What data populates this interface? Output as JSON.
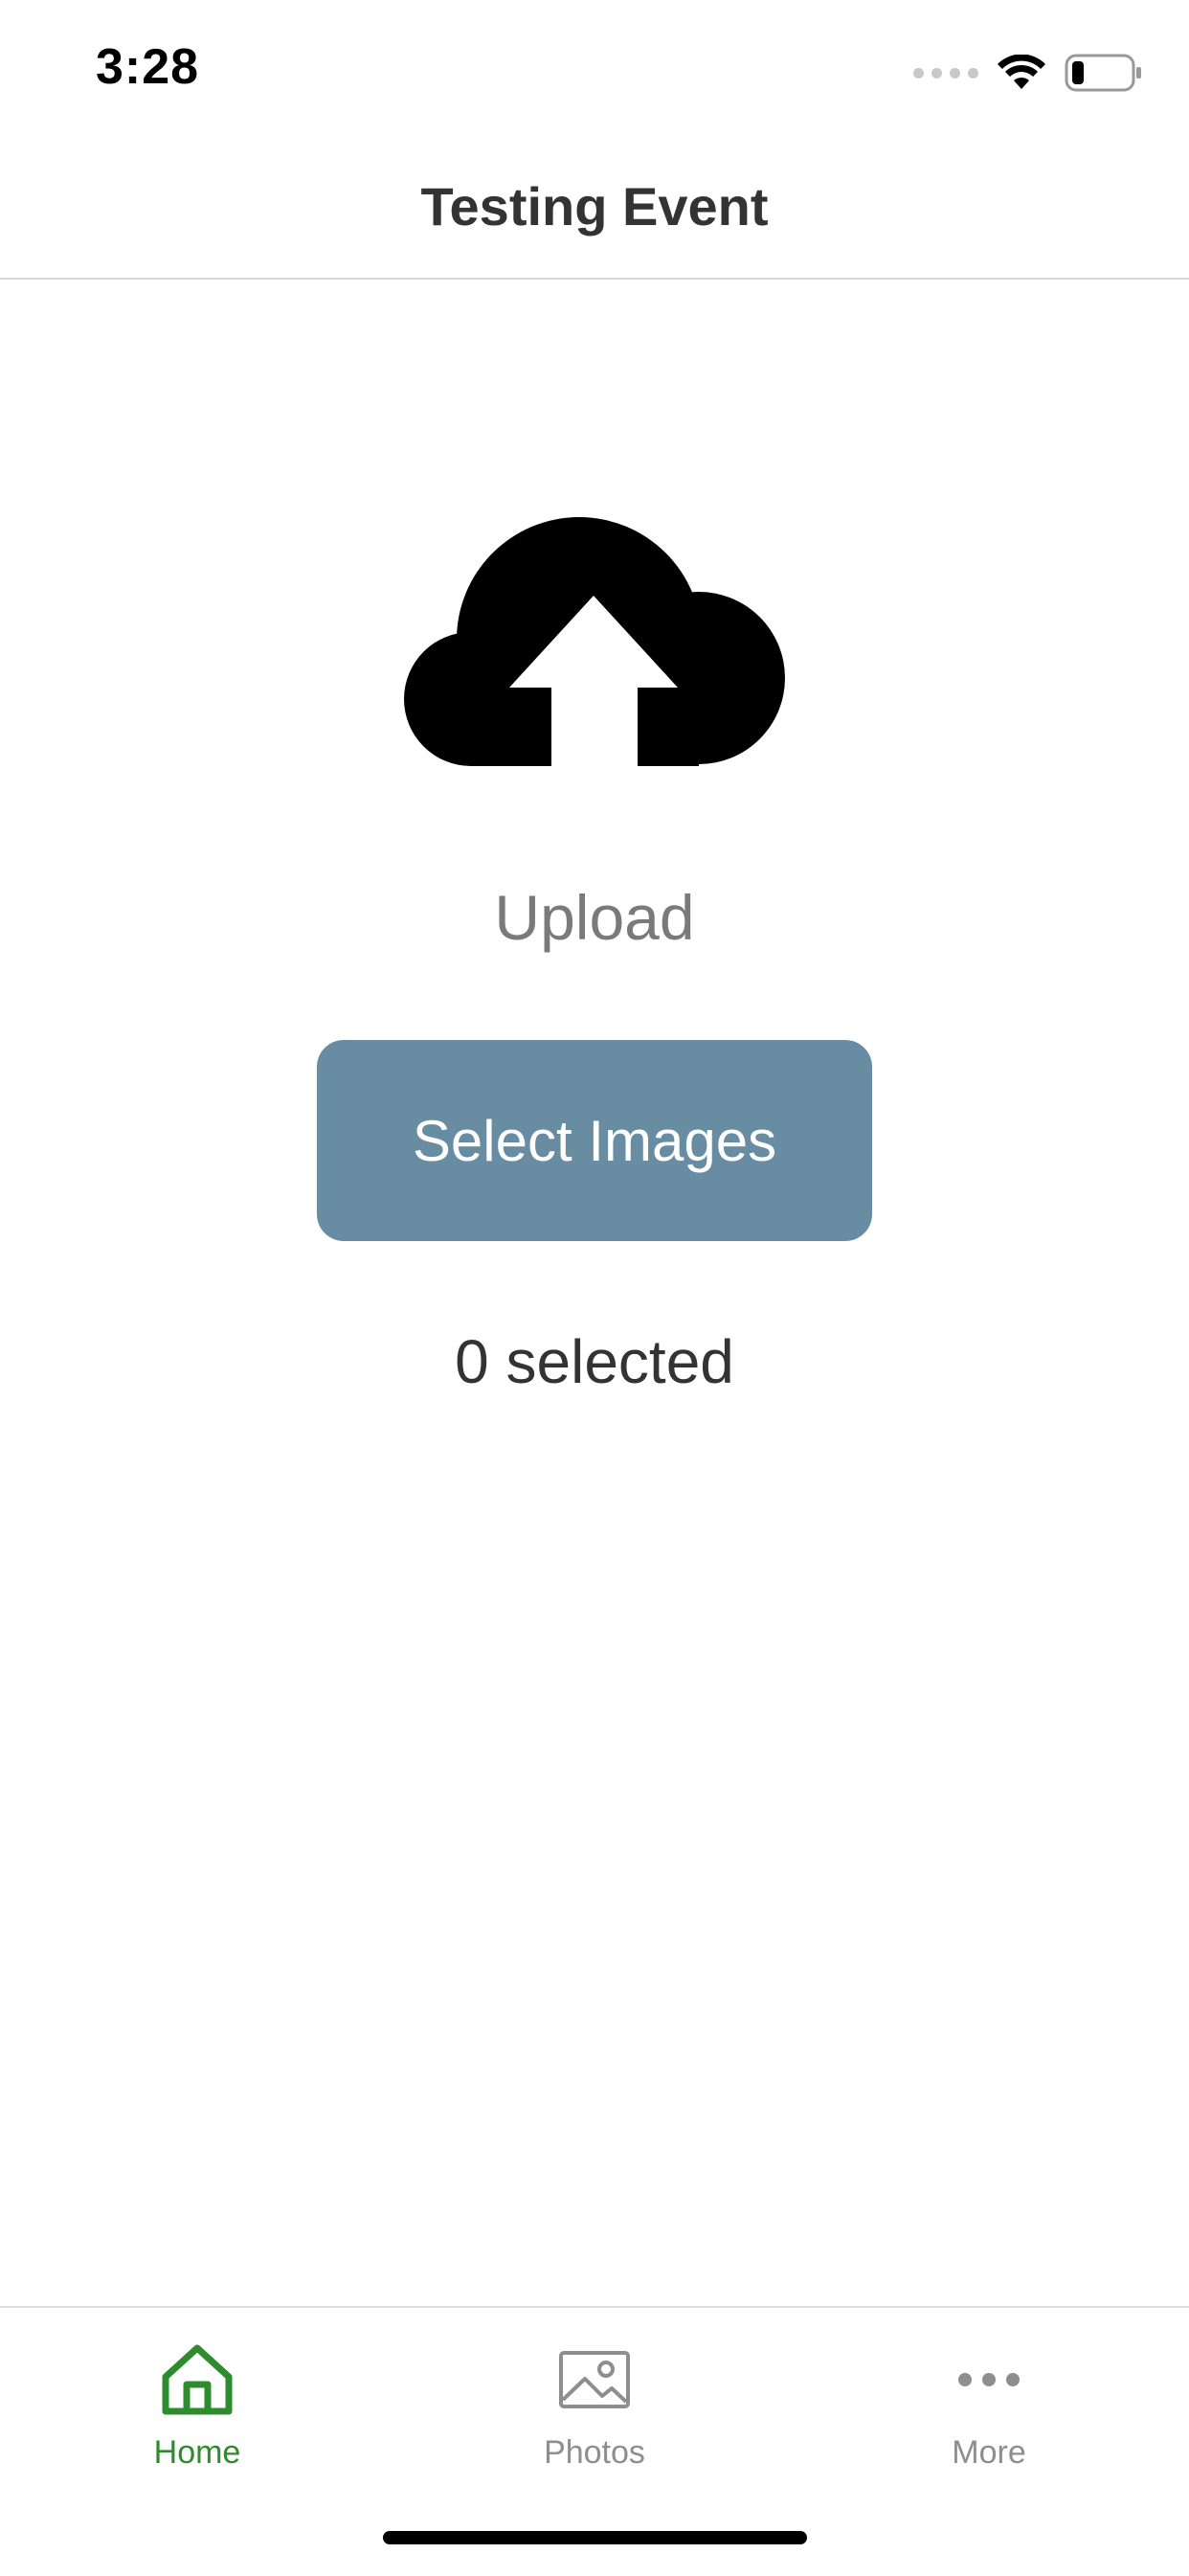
{
  "status_bar": {
    "time": "3:28"
  },
  "header": {
    "title": "Testing Event"
  },
  "upload": {
    "icon": "cloud-upload-icon",
    "heading": "Upload",
    "button_label": "Select Images",
    "selected_count": "0 selected"
  },
  "colors": {
    "button_background": "#688ca2",
    "tab_active": "#2e8b2e",
    "tab_inactive": "#8e8e8e"
  },
  "tabs": [
    {
      "label": "Home",
      "icon": "home-icon",
      "active": true
    },
    {
      "label": "Photos",
      "icon": "image-icon",
      "active": false
    },
    {
      "label": "More",
      "icon": "more-dots-icon",
      "active": false
    }
  ]
}
